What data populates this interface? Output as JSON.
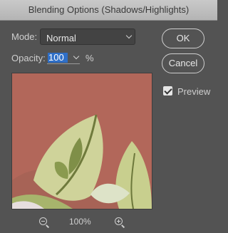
{
  "window": {
    "title": "Blending Options (Shadows/Highlights)"
  },
  "mode": {
    "label": "Mode:",
    "value": "Normal"
  },
  "opacity": {
    "label": "Opacity:",
    "value": "100",
    "unit": "%"
  },
  "buttons": {
    "ok": "OK",
    "cancel": "Cancel"
  },
  "preview_option": {
    "label": "Preview",
    "checked": true
  },
  "zoom": {
    "level": "100%",
    "zoom_out_icon": "zoom-out-icon",
    "zoom_in_icon": "zoom-in-icon"
  },
  "colors": {
    "dialog_bg": "#535353",
    "titlebar": "#bdbdbd",
    "selection": "#2f6fc7",
    "preview_bg": "#b2675a"
  }
}
